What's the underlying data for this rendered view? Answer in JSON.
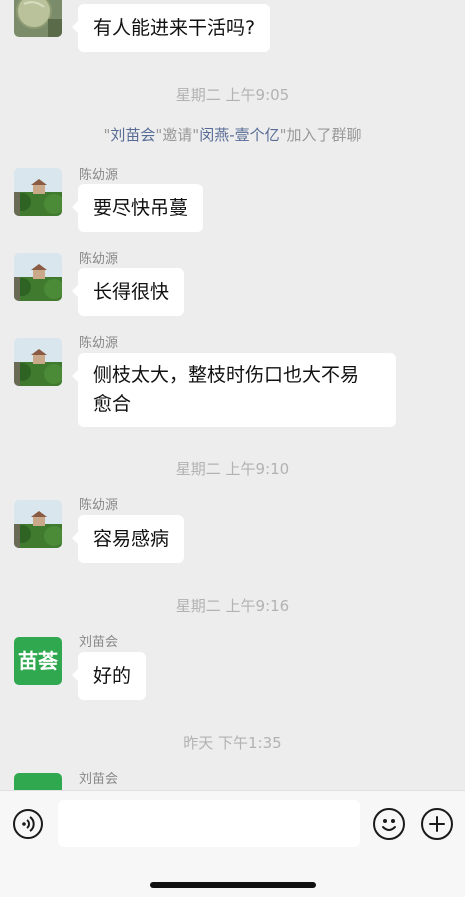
{
  "messages": [
    {
      "text": "有人能进来干活吗?"
    },
    {
      "sender": "陈幼源",
      "text": "要尽快吊蔓"
    },
    {
      "sender": "陈幼源",
      "text": "长得很快"
    },
    {
      "sender": "陈幼源",
      "text_line1": "侧枝太大，整枝时伤口也大不易",
      "text_line2": "愈合"
    },
    {
      "sender": "陈幼源",
      "text": "容易感病"
    },
    {
      "sender": "刘苗会",
      "text": "好的"
    },
    {
      "sender": "刘苗会"
    }
  ],
  "timestamps": [
    "星期二 上午9:05",
    "星期二 上午9:10",
    "星期二 上午9:16",
    "昨天 下午1:35"
  ],
  "system_message": {
    "open_quote": "\"",
    "inviter": "刘苗会",
    "mid": "\"邀请\"",
    "invitee": "闵燕-壹个亿",
    "end": "\"加入了群聊"
  },
  "liu_avatar_text": "苗荟",
  "colors": {
    "background": "#ededed",
    "bubble": "#ffffff",
    "link_name": "#576b95",
    "timestamp": "#b2b2b2",
    "liu_avatar": "#2fa84f"
  },
  "icons": {
    "voice": "voice-icon",
    "emoji": "emoji-icon",
    "plus": "plus-icon"
  },
  "input": {
    "value": ""
  }
}
